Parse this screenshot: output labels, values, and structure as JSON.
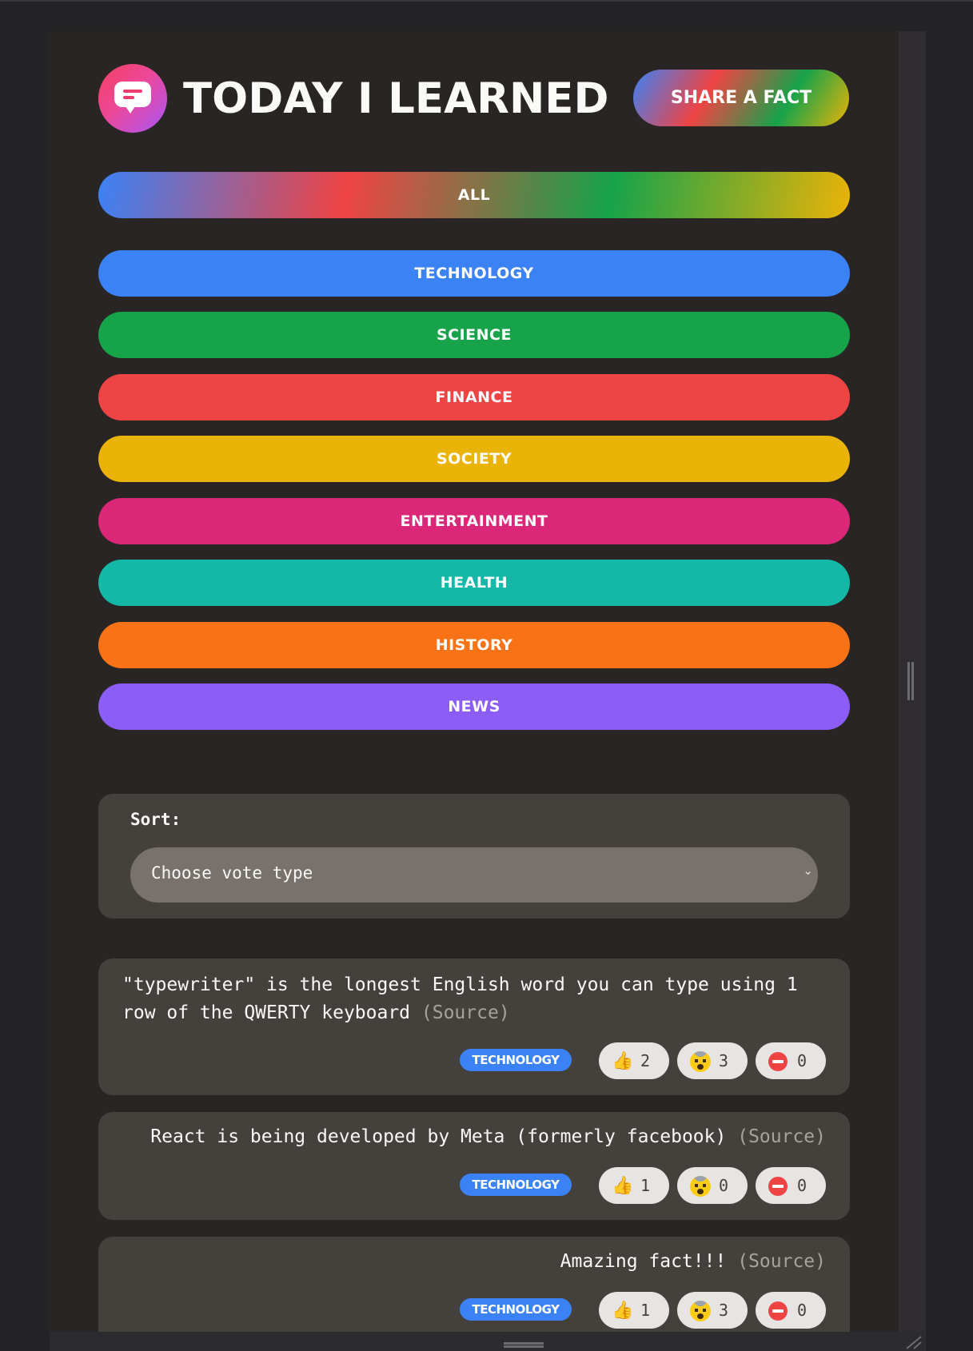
{
  "header": {
    "title": "Today I Learned",
    "share_label": "Share a fact"
  },
  "categories": {
    "all": "All",
    "items": [
      {
        "label": "technology",
        "color": "#3b82f6"
      },
      {
        "label": "science",
        "color": "#16a34a"
      },
      {
        "label": "finance",
        "color": "#ef4444"
      },
      {
        "label": "society",
        "color": "#eab308"
      },
      {
        "label": "entertainment",
        "color": "#db2777"
      },
      {
        "label": "health",
        "color": "#14b8a6"
      },
      {
        "label": "history",
        "color": "#f97316"
      },
      {
        "label": "news",
        "color": "#8b5cf6"
      }
    ]
  },
  "sort": {
    "label": "Sort:",
    "selected": "Choose vote type"
  },
  "facts": [
    {
      "text": "\"typewriter\" is the longest English word you can type using 1 row of the QWERTY keyboard",
      "source_label": "(Source)",
      "category": "technology",
      "votes": {
        "interesting": "2",
        "mindblowing": "3",
        "false": "0"
      }
    },
    {
      "text": "React is being developed by Meta (formerly facebook)",
      "source_label": "(Source)",
      "category": "technology",
      "votes": {
        "interesting": "1",
        "mindblowing": "0",
        "false": "0"
      }
    },
    {
      "text": "Amazing fact!!!",
      "source_label": "(Source)",
      "category": "technology",
      "votes": {
        "interesting": "1",
        "mindblowing": "3",
        "false": "0"
      }
    }
  ],
  "icons": {
    "logo": "speech-bubble-icon",
    "vote_interesting": "thumbs-up-icon",
    "vote_mindblowing": "mind-blown-icon",
    "vote_false": "no-entry-icon"
  }
}
